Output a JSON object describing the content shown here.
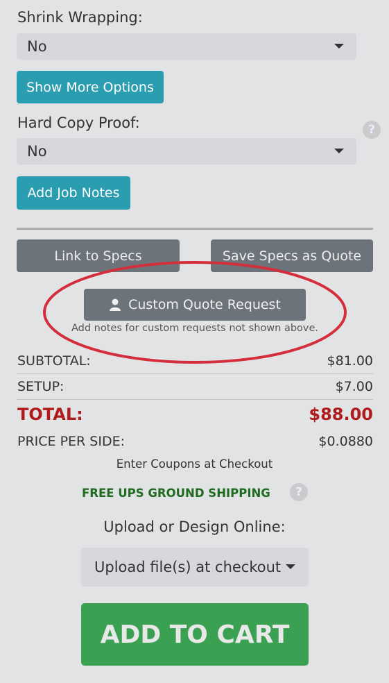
{
  "shrink_wrapping": {
    "label": "Shrink Wrapping:",
    "value": "No"
  },
  "show_more_options": "Show More Options",
  "hard_copy_proof": {
    "label": "Hard Copy Proof:",
    "value": "No",
    "help_icon": "question-circle-icon"
  },
  "add_job_notes": "Add Job Notes",
  "link_to_specs": "Link to Specs",
  "save_specs_as_quote": "Save Specs as Quote",
  "custom_quote": {
    "button_label": "Custom Quote Request",
    "icon": "user-icon",
    "note": "Add notes for custom requests not shown above.",
    "highlight_color": "#d42e3c"
  },
  "pricing": {
    "subtotal_label": "SUBTOTAL:",
    "subtotal_value": "$81.00",
    "setup_label": "SETUP:",
    "setup_value": "$7.00",
    "total_label": "TOTAL:",
    "total_value": "$88.00",
    "total_color": "#b01c1c",
    "price_per_side_label": "PRICE PER SIDE:",
    "price_per_side_value": "$0.0880"
  },
  "coupons_note": "Enter Coupons at Checkout",
  "shipping": {
    "text": "FREE UPS GROUND SHIPPING",
    "color": "#1f6b1f",
    "help_icon": "question-circle-icon"
  },
  "upload": {
    "label": "Upload or Design Online:",
    "dropdown_value": "Upload file(s) at checkout"
  },
  "add_to_cart": {
    "label": "ADD TO CART",
    "color": "#3aa153"
  }
}
